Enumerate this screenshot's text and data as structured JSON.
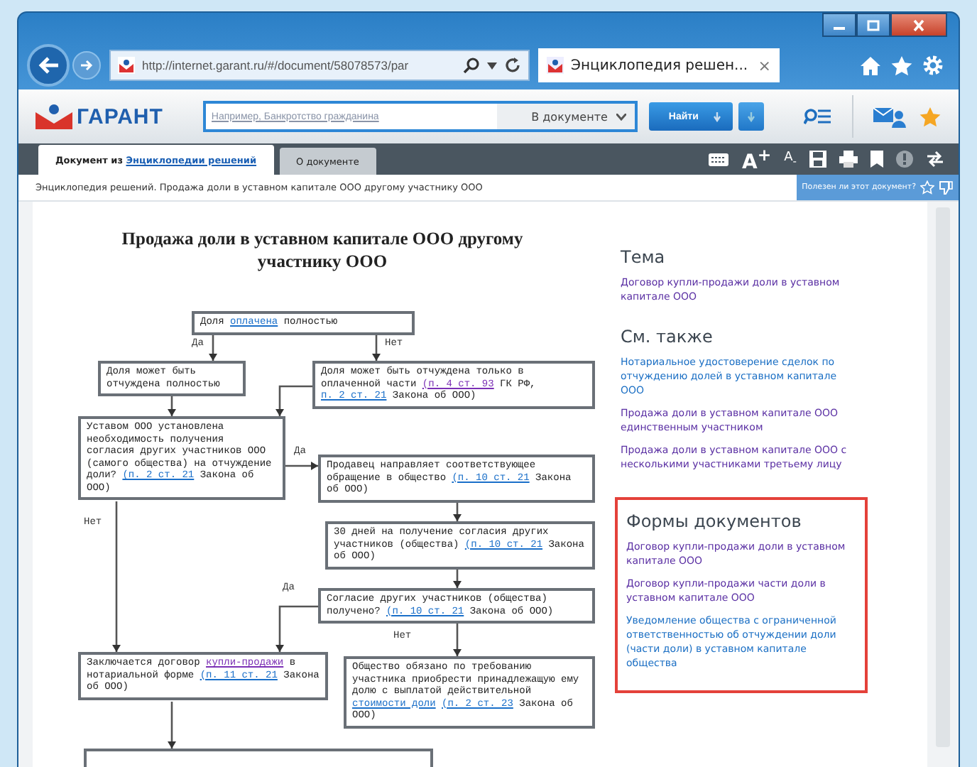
{
  "browser": {
    "url": "http://internet.garant.ru/#/document/58078573/par",
    "tab_title": "Энциклопедия решен...",
    "tab_close": "×"
  },
  "toolbar": {
    "logo": "ГАРАНТ",
    "search_placeholder": "Например, Банкротство гражданина",
    "scope": "В документе",
    "find_button": "Найти"
  },
  "doc_tabs": [
    {
      "segments": [
        {
          "text": "Документ из ",
          "kind": "plain"
        },
        {
          "text": "Энциклопедии решений",
          "kind": "link"
        }
      ],
      "selected": true
    },
    {
      "segments": [
        {
          "text": "О документе",
          "kind": "plain"
        }
      ],
      "selected": false
    }
  ],
  "font_buttons": [
    "A$^{+}$",
    "A$_{-}$"
  ],
  "breadcrumb": "Энциклопедия решений. Продажа доли в уставном капитале ООО другому участнику ООО",
  "feedback": "Полезен ли этот документ?",
  "flowchart": {
    "title": "Продажа доли в уставном капитале ООО другому участнику ООО",
    "nodes": [
      {
        "segments": [
          {
            "text": "Доля ",
            "kind": "plain"
          },
          {
            "text": "оплачена",
            "kind": "link"
          },
          {
            "text": " полностью",
            "kind": "plain"
          }
        ]
      },
      {
        "segments": [
          {
            "text": "Доля может быть отчуждена полностью",
            "kind": "plain"
          }
        ]
      },
      {
        "segments": [
          {
            "text": "Доля может быть отчуждена только в оплаченной части ",
            "kind": "plain"
          },
          {
            "text": "(п. 4 ст. 93",
            "kind": "visited"
          },
          {
            "text": " ГК РФ, ",
            "kind": "plain"
          },
          {
            "text": "п. 2 ст. 21",
            "kind": "link"
          },
          {
            "text": " Закона об ООО)",
            "kind": "plain"
          }
        ]
      },
      {
        "segments": [
          {
            "text": "Уставом ООО установлена необходимость получения согласия других участников ООО (самого общества) на отчуждение доли? ",
            "kind": "plain"
          },
          {
            "text": "(п. 2 ст. 21",
            "kind": "link"
          },
          {
            "text": " Закона об ООО)",
            "kind": "plain"
          }
        ]
      },
      {
        "segments": [
          {
            "text": "Продавец направляет соответствующее обращение в общество ",
            "kind": "plain"
          },
          {
            "text": "(п. 10 ст. 21",
            "kind": "link"
          },
          {
            "text": " Закона об ООО)",
            "kind": "plain"
          }
        ]
      },
      {
        "segments": [
          {
            "text": "30 дней на получение согласия других участников (общества) ",
            "kind": "plain"
          },
          {
            "text": "(п. 10 ст. 21",
            "kind": "link"
          },
          {
            "text": " Закона об ООО)",
            "kind": "plain"
          }
        ]
      },
      {
        "segments": [
          {
            "text": "Согласие других участников (общества) получено? ",
            "kind": "plain"
          },
          {
            "text": "(п. 10 ст. 21",
            "kind": "link"
          },
          {
            "text": " Закона об ООО)",
            "kind": "plain"
          }
        ]
      },
      {
        "segments": [
          {
            "text": "Заключается договор ",
            "kind": "plain"
          },
          {
            "text": "купли-продажи",
            "kind": "visited"
          },
          {
            "text": " в нотариальной форме ",
            "kind": "plain"
          },
          {
            "text": "(п. 11 ст. 21",
            "kind": "link"
          },
          {
            "text": " Закона об ООО)",
            "kind": "plain"
          }
        ]
      },
      {
        "segments": [
          {
            "text": "Общество обязано по требованию участника приобрести принадлежащую ему долю с выплатой действительной ",
            "kind": "plain"
          },
          {
            "text": "стоимости доли",
            "kind": "link"
          },
          {
            "text": "(п. 2 ст. 23",
            "kind": "link"
          },
          {
            "text": " Закона об ООО)",
            "kind": "plain"
          }
        ]
      }
    ],
    "edge_labels": [
      "Да",
      "Нет",
      "Да",
      "Нет",
      "Да",
      "Нет"
    ]
  },
  "sidebar": [
    {
      "title": "Тема",
      "highlighted": false,
      "links": [
        {
          "text": "Договор купли-продажи доли в уставном капитале ООО",
          "visited": true
        }
      ]
    },
    {
      "title": "См. также",
      "highlighted": false,
      "links": [
        {
          "text": "Нотариальное удостоверение сделок по отчуждению долей в уставном капитале ООО",
          "visited": false
        },
        {
          "text": "Продажа доли в уставном капитале ООО единственным участником",
          "visited": true
        },
        {
          "text": "Продажа доли в уставном капитале ООО с несколькими участниками третьему лицу",
          "visited": true
        }
      ]
    },
    {
      "title": "Формы документов",
      "highlighted": true,
      "links": [
        {
          "text": "Договор купли-продажи доли в уставном капитале ООО",
          "visited": true
        },
        {
          "text": "Договор купли-продажи части доли в уставном капитале ООО",
          "visited": true
        },
        {
          "text": "Уведомление общества с ограниченной ответственностью об отчуждении доли (части доли) в уставном капитале общества",
          "visited": false
        }
      ]
    }
  ]
}
